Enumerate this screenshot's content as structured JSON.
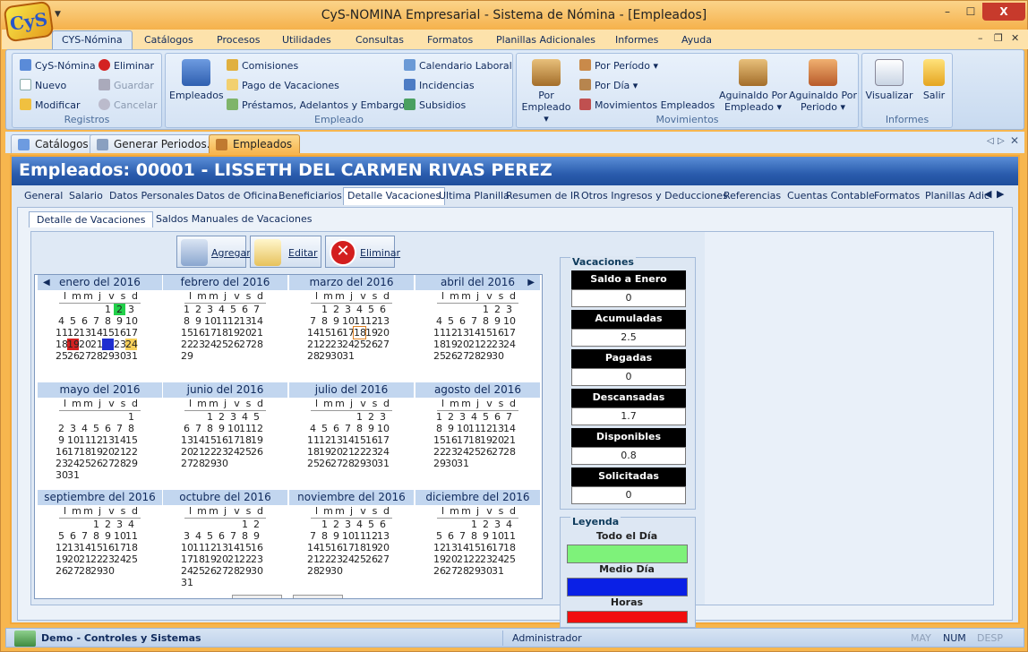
{
  "window": {
    "title": "CyS-NOMINA Empresarial - Sistema de Nómina - [Empleados]",
    "logo": "CyS",
    "qat_icon": "dropdown-arrow-icon",
    "minimize": "–",
    "maximize": "☐",
    "close": "X"
  },
  "menu": {
    "items": [
      "CYS-Nómina",
      "Catálogos",
      "Procesos",
      "Utilidades",
      "Consultas",
      "Formatos",
      "Planillas Adicionales",
      "Informes",
      "Ayuda"
    ],
    "active": "CYS-Nómina"
  },
  "ribbon": {
    "registros": {
      "caption": "Registros",
      "cys_nomina": "CyS-Nómina",
      "nuevo": "Nuevo",
      "modificar": "Modificar",
      "eliminar": "Eliminar",
      "guardar": "Guardar",
      "cancelar": "Cancelar"
    },
    "empleado": {
      "caption": "Empleado",
      "empleados": "Empleados",
      "comisiones": "Comisiones",
      "pago_vacaciones": "Pago de Vacaciones",
      "prestamos": "Préstamos, Adelantos y Embargos",
      "calendario": "Calendario Laboral",
      "incidencias": "Incidencias",
      "subsidios": "Subsidios"
    },
    "movimientos": {
      "caption": "Movimientos",
      "por_empleado": "Por Empleado",
      "por_periodo": "Por Período",
      "por_dia": "Por Día",
      "movimientos_empleados": "Movimientos Empleados",
      "aguinaldo_empleado": "Aguinaldo Por Empleado",
      "aguinaldo_periodo": "Aguinaldo Por Periodo"
    },
    "informes": {
      "caption": "Informes",
      "visualizar": "Visualizar",
      "salir": "Salir"
    }
  },
  "doc_tabs": [
    {
      "label": "Catálogos",
      "icon": "folder-icon"
    },
    {
      "label": "Generar Periodos...",
      "icon": "gear-icon"
    },
    {
      "label": "Empleados",
      "icon": "people-icon",
      "active": true
    }
  ],
  "header": {
    "title": "Empleados: 00001 - LISSETH DEL CARMEN RIVAS PEREZ"
  },
  "sub_tabs": [
    "General",
    "Salario",
    "Datos Personales",
    "Datos de Oficina",
    "Beneficiarios",
    "Detalle Vacaciones",
    "Ultima Planilla",
    "Resumen de IR",
    "Otros Ingresos y Deducciones",
    "Referencias",
    "Cuentas Contable",
    "Formatos",
    "Planillas Adic"
  ],
  "sub_tab_active": "Detalle Vacaciones",
  "inner_tabs": [
    "Detalle de Vacaciones",
    "Saldos Manuales de Vacaciones"
  ],
  "actions": {
    "agregar": "Agregar",
    "editar": "Editar",
    "eliminar": "Eliminar"
  },
  "calendar": {
    "year": 2016,
    "dow": [
      "l",
      "m",
      "m",
      "j",
      "v",
      "s",
      "d"
    ],
    "months": [
      {
        "name": "enero del 2016",
        "start": 4,
        "days": 31
      },
      {
        "name": "febrero del 2016",
        "start": 0,
        "days": 29
      },
      {
        "name": "marzo del 2016",
        "start": 1,
        "days": 31
      },
      {
        "name": "abril del 2016",
        "start": 4,
        "days": 30
      },
      {
        "name": "mayo del 2016",
        "start": 6,
        "days": 31
      },
      {
        "name": "junio del 2016",
        "start": 2,
        "days": 30
      },
      {
        "name": "julio del 2016",
        "start": 4,
        "days": 31
      },
      {
        "name": "agosto del 2016",
        "start": 0,
        "days": 31
      },
      {
        "name": "septiembre del 2016",
        "start": 3,
        "days": 30
      },
      {
        "name": "octubre del 2016",
        "start": 5,
        "days": 31
      },
      {
        "name": "noviembre del 2016",
        "start": 1,
        "days": 30
      },
      {
        "name": "diciembre del 2016",
        "start": 3,
        "days": 31
      }
    ],
    "marks": [
      {
        "month": 0,
        "day": 2,
        "type": "full"
      },
      {
        "month": 0,
        "day": 19,
        "type": "hours"
      },
      {
        "month": 0,
        "day": 22,
        "type": "half"
      },
      {
        "month": 0,
        "day": 24,
        "type": "sol"
      },
      {
        "month": 2,
        "day": 18,
        "type": "today"
      }
    ]
  },
  "vacaciones": {
    "title": "Vacaciones",
    "rows": [
      {
        "label": "Saldo a Enero",
        "value": "0"
      },
      {
        "label": "Acumuladas",
        "value": "2.5"
      },
      {
        "label": "Pagadas",
        "value": "0"
      },
      {
        "label": "Descansadas",
        "value": "1.7"
      },
      {
        "label": "Disponibles",
        "value": "0.8"
      },
      {
        "label": "Solicitadas",
        "value": "0"
      }
    ]
  },
  "leyenda": {
    "title": "Leyenda",
    "items": [
      {
        "label": "Todo el Día",
        "color": "#7ef27a"
      },
      {
        "label": "Medio Día",
        "color": "#0a20e6"
      },
      {
        "label": "Horas",
        "color": "#f10e0e"
      }
    ]
  },
  "status": {
    "company": "Demo - Controles y Sistemas",
    "user": "Administrador",
    "may": "MAY",
    "num": "NUM",
    "desp": "DESP"
  },
  "colors": {
    "accent": "#f6b650",
    "header": "#2a5cad"
  }
}
